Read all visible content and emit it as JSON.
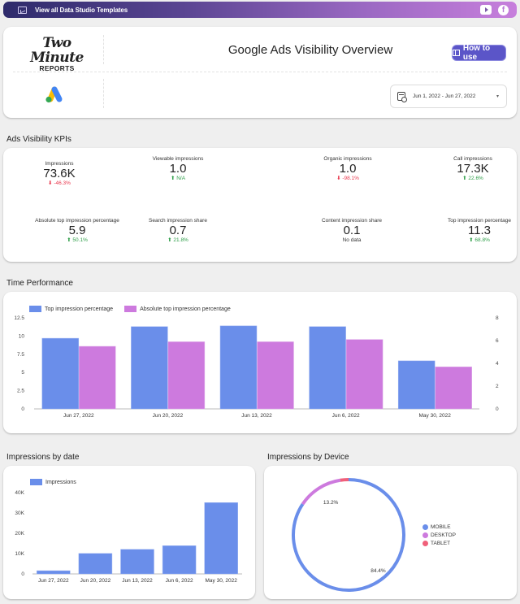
{
  "topbar": {
    "link_label": "View all Data Studio Templates",
    "icons": [
      "line-chart-icon",
      "youtube-icon",
      "facebook-icon"
    ]
  },
  "header": {
    "logo_line1": "Two Minute",
    "logo_line2": "REPORTS",
    "title": "Google Ads Visibility Overview",
    "how_to_use_label": "How to use",
    "date_range": "Jun 1, 2022 - Jun 27, 2022",
    "date_caret": "▾"
  },
  "kpi_section": {
    "title": "Ads Visibility KPIs",
    "kpis": [
      {
        "label": "Impressions",
        "value": "73.6K",
        "change": "-46.3%",
        "direction": "down",
        "status": "neg"
      },
      {
        "label": "Viewable impressions",
        "value": "1.0",
        "change": "N/A",
        "direction": "up",
        "status": "pos"
      },
      {
        "label": "Organic impressions",
        "value": "1.0",
        "change": "-98.1%",
        "direction": "down",
        "status": "neg"
      },
      {
        "label": "Call impressions",
        "value": "17.3K",
        "change": "22.6%",
        "direction": "up",
        "status": "pos"
      },
      {
        "label": "Absolute top impression percentage",
        "value": "5.9",
        "change": "50.1%",
        "direction": "up",
        "status": "pos"
      },
      {
        "label": "Search impression share",
        "value": "0.7",
        "change": "21.8%",
        "direction": "up",
        "status": "pos"
      },
      {
        "label": "Content impression share",
        "value": "0.1",
        "change": "No data",
        "direction": "",
        "status": "none"
      },
      {
        "label": "Top impression percentage",
        "value": "11.3",
        "change": "68.8%",
        "direction": "up",
        "status": "pos"
      }
    ]
  },
  "colors": {
    "blue": "#6a8eea",
    "purple": "#cd7ade",
    "pink": "#f0607a",
    "accent": "#5b55c8",
    "neg": "#e8354b",
    "pos": "#2e9e48"
  },
  "chart_data": [
    {
      "id": "time_performance",
      "type": "bar",
      "title": "Time Performance",
      "categories": [
        "Jun 27, 2022",
        "Jun 20, 2022",
        "Jun 13, 2022",
        "Jun 6, 2022",
        "May 30, 2022"
      ],
      "series": [
        {
          "name": "Top impression percentage",
          "axis": "left",
          "color": "#6a8eea",
          "values": [
            9.7,
            11.3,
            11.4,
            11.3,
            6.6
          ]
        },
        {
          "name": "Absolute top impression percentage",
          "axis": "right",
          "color": "#cd7ade",
          "values": [
            5.5,
            5.9,
            5.9,
            6.1,
            3.7
          ]
        }
      ],
      "y_left": {
        "ticks": [
          "0",
          "2.5",
          "5",
          "7.5",
          "10",
          "12.5"
        ],
        "range": [
          0,
          12.5
        ]
      },
      "y_right": {
        "ticks": [
          "0",
          "2",
          "4",
          "6",
          "8"
        ],
        "range": [
          0,
          8
        ]
      },
      "legend": "top-left",
      "grid": false
    },
    {
      "id": "impressions_by_date",
      "type": "bar",
      "title": "Impressions by date",
      "categories": [
        "Jun 27, 2022",
        "Jun 20, 2022",
        "Jun 13, 2022",
        "Jun 6, 2022",
        "May 30, 2022"
      ],
      "series": [
        {
          "name": "Impressions",
          "color": "#6a8eea",
          "values": [
            1600,
            10100,
            12100,
            13900,
            35100
          ]
        }
      ],
      "y_ticks": [
        "0",
        "10K",
        "20K",
        "30K",
        "40K"
      ],
      "ylim": [
        0,
        40000
      ],
      "legend": "top-left",
      "grid": false
    },
    {
      "id": "impressions_by_device",
      "type": "pie",
      "title": "Impressions by Device",
      "slices": [
        {
          "label": "MOBILE",
          "value": 84.4,
          "display": "84.4%",
          "color": "#6a8eea"
        },
        {
          "label": "DESKTOP",
          "value": 13.2,
          "display": "13.2%",
          "color": "#cd7ade"
        },
        {
          "label": "TABLET",
          "value": 2.4,
          "display": "",
          "color": "#f0607a"
        }
      ],
      "legend": "right",
      "donut": true
    }
  ]
}
